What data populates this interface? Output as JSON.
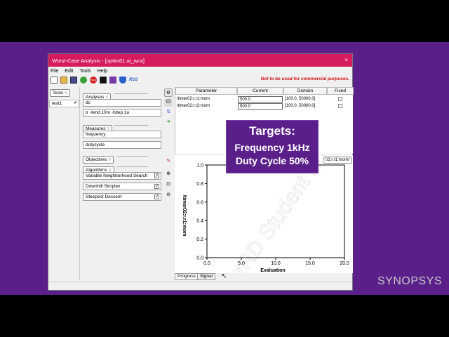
{
  "window": {
    "title": "Worst-Case Analysis - [optim01.ai_wca]",
    "close_glyph": "×"
  },
  "menu": {
    "items": [
      "File",
      "Edit",
      "Tools",
      "Help"
    ]
  },
  "toolbar": {
    "stop_label": "Stop",
    "rss_label": "RSS",
    "notice": "Not to be used for commercial purposes."
  },
  "tests": {
    "header": "Tests",
    "items": [
      {
        "label": "test1"
      }
    ]
  },
  "analyses": {
    "header": "Analyses",
    "items": [
      "dc",
      "tr -tend 10m -tstep 1u"
    ]
  },
  "measures": {
    "header": "Measures",
    "items": [
      "frequency",
      "dutycycle"
    ]
  },
  "objectives": {
    "header": "Objectives"
  },
  "algorithms": {
    "header": "Algorithms",
    "items": [
      "Variable Neighborhood Search",
      "Downhill Simplex",
      "Steepest Descent"
    ]
  },
  "param_table": {
    "headers": {
      "parameter": "Parameter",
      "current": "Current",
      "domain": "Domain",
      "fixed": "Fixed"
    },
    "rows": [
      {
        "parameter": "/timer02:r.r1:mom",
        "current": "500.0",
        "domain": "[100.0, 50000.0]"
      },
      {
        "parameter": "/timer02:r.r2:mom",
        "current": "500.0",
        "domain": "[100.0, 50000.0]"
      }
    ]
  },
  "plot": {
    "select_value": "02:r.r1:mom",
    "xlabel": "Evaluation",
    "ylabel": "/timer02:r.r1:mom",
    "watermark": "SaberRD Student Edition"
  },
  "chart_data": {
    "type": "line",
    "title": "",
    "xlabel": "Evaluation",
    "ylabel": "/timer02:r.r1:mom",
    "xlim": [
      0,
      20
    ],
    "ylim": [
      0,
      1
    ],
    "xticks": [
      "0.0",
      "5.0",
      "10.0",
      "15.0",
      "20.0"
    ],
    "yticks": [
      "0.0",
      "0.2",
      "0.4",
      "0.6",
      "0.8",
      "1.0"
    ],
    "grid": false,
    "series": []
  },
  "plot_tabs": [
    "Progress",
    "Signal"
  ],
  "overlay": {
    "line1": "Targets:",
    "line2": "Frequency 1kHz",
    "line3": "Duty Cycle 50%"
  },
  "brand": "SYNOPSYS",
  "colors": {
    "background": "#5b1f8a",
    "titlebar": "#d51b5e",
    "notice": "#d01010"
  }
}
